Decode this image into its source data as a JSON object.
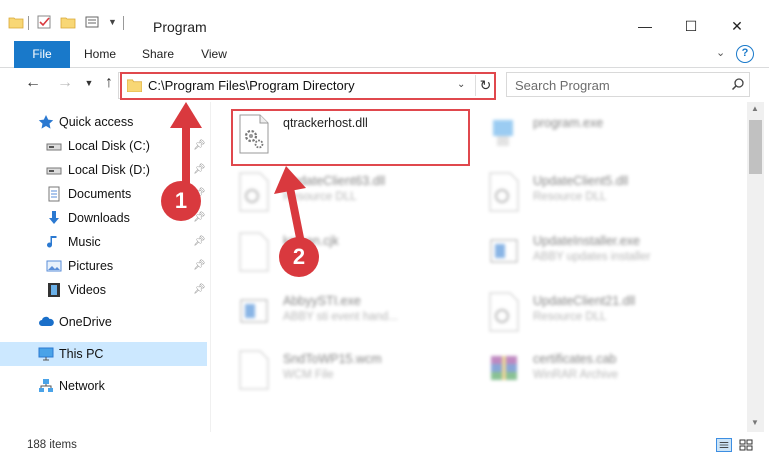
{
  "window": {
    "title": "Program",
    "minimize": "—",
    "maximize": "☐",
    "close": "✕"
  },
  "ribbon": {
    "tabs": [
      "File",
      "Home",
      "Share",
      "View"
    ],
    "help": "?"
  },
  "address": {
    "path": "C:\\Program Files\\Program Directory",
    "refresh": "↻"
  },
  "search": {
    "placeholder": "Search Program"
  },
  "sidebar": {
    "items": [
      {
        "label": "Quick access",
        "icon": "star-icon",
        "pinned": false
      },
      {
        "label": "Local Disk (C:)",
        "icon": "drive-icon",
        "pinned": true
      },
      {
        "label": "Local Disk (D:)",
        "icon": "drive-icon",
        "pinned": true
      },
      {
        "label": "Documents",
        "icon": "documents-icon",
        "pinned": true
      },
      {
        "label": "Downloads",
        "icon": "download-arrow-icon",
        "pinned": true
      },
      {
        "label": "Music",
        "icon": "music-note-icon",
        "pinned": true
      },
      {
        "label": "Pictures",
        "icon": "pictures-icon",
        "pinned": true
      },
      {
        "label": "Videos",
        "icon": "film-icon",
        "pinned": true
      },
      {
        "label": "OneDrive",
        "icon": "cloud-icon",
        "pinned": false
      },
      {
        "label": "This PC",
        "icon": "monitor-icon",
        "pinned": false,
        "selected": true
      },
      {
        "label": "Network",
        "icon": "network-icon",
        "pinned": false
      }
    ]
  },
  "files": {
    "highlighted": {
      "name": "qtrackerhost.dll",
      "type": ""
    },
    "items": [
      {
        "name": "program.exe",
        "type": ""
      },
      {
        "name": "UpdateClient63.dll",
        "type": "Resource DLL"
      },
      {
        "name": "UpdateClient5.dll",
        "type": "Resource DLL"
      },
      {
        "name": "ksman.cjk",
        "type": ""
      },
      {
        "name": "UpdateInstaller.exe",
        "type": "ABBY updates installer"
      },
      {
        "name": "AbbyySTI.exe",
        "type": "ABBY sti event hand..."
      },
      {
        "name": "UpdateClient21.dll",
        "type": "Resource DLL"
      },
      {
        "name": "SndToWP15.wcm",
        "type": "WCM File"
      },
      {
        "name": "certificates.cab",
        "type": "WinRAR Archive"
      }
    ]
  },
  "status": {
    "count": "188 items"
  },
  "callouts": [
    "1",
    "2"
  ],
  "colors": {
    "accent": "#1979ca",
    "highlight": "#e0484d",
    "selection": "#cce8ff"
  }
}
